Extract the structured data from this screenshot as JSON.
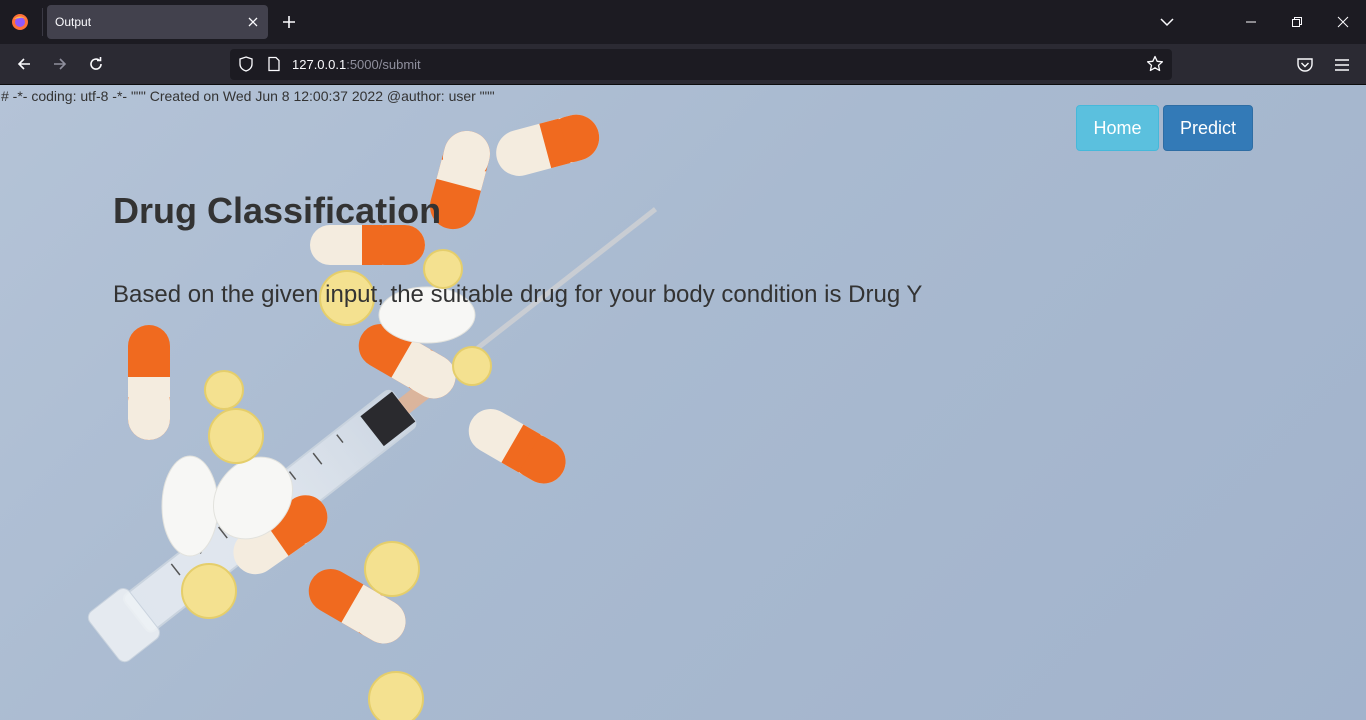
{
  "browser": {
    "tab": {
      "title": "Output"
    },
    "url": {
      "host": "127.0.0.1",
      "path": ":5000/submit"
    }
  },
  "page": {
    "comment": "# -*- coding: utf-8 -*- \"\"\" Created on Wed Jun 8 12:00:37 2022 @author: user \"\"\"",
    "nav": {
      "home_label": "Home",
      "predict_label": "Predict"
    },
    "title": "Drug Classification",
    "result": "Based on the given input, the suitable drug for your body condition is Drug Y"
  },
  "colors": {
    "home_button": "#5bc0de",
    "predict_button": "#337ab7",
    "background": "#aebfd4"
  },
  "icons": [
    "firefox-icon",
    "close-icon",
    "plus-icon",
    "chevron-down-icon",
    "minimize-icon",
    "restore-icon",
    "window-close-icon",
    "back-icon",
    "forward-icon",
    "reload-icon",
    "shield-icon",
    "page-icon",
    "star-icon",
    "pocket-icon",
    "menu-icon"
  ]
}
